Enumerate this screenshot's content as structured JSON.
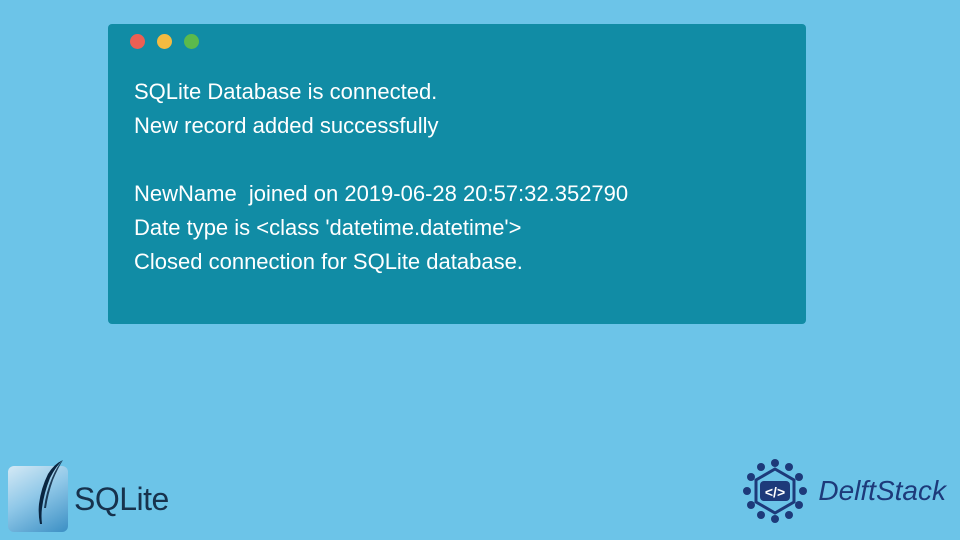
{
  "terminal": {
    "lines": [
      "SQLite Database is connected.",
      "New record added successfully",
      "",
      "NewName  joined on 2019-06-28 20:57:32.352790",
      "Date type is <class 'datetime.datetime'>",
      "Closed connection for SQLite database."
    ]
  },
  "logos": {
    "sqlite": "SQLite",
    "delftstack": "DelftStack"
  },
  "colors": {
    "background": "#6cc4e8",
    "terminal_bg": "#118ca5",
    "terminal_text": "#ffffff",
    "traffic_red": "#ec5f54",
    "traffic_yellow": "#f4bb41",
    "traffic_green": "#5bba4c"
  }
}
